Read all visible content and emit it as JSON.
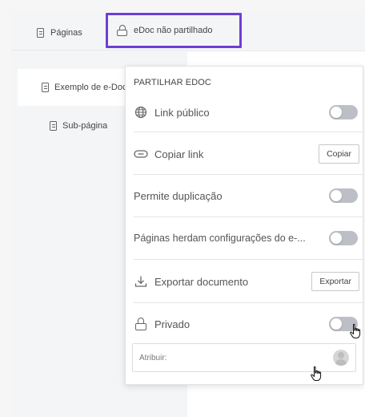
{
  "tabs": {
    "pages_label": "Páginas",
    "edoc_label": "eDoc não partilhado"
  },
  "sidebar": {
    "items": [
      {
        "label": "Exemplo de e-Doc"
      },
      {
        "label": "Sub-página"
      }
    ]
  },
  "share_menu": {
    "title": "PARTILHAR EDOC",
    "public_link": {
      "label": "Link público",
      "enabled": false
    },
    "copy_link": {
      "label": "Copiar link",
      "button": "Copiar"
    },
    "allow_duplication": {
      "label": "Permite duplicação",
      "enabled": false
    },
    "pages_inherit": {
      "label": "Páginas herdam configurações do e-...",
      "enabled": false
    },
    "export": {
      "label": "Exportar documento",
      "button": "Exportar"
    },
    "private": {
      "label": "Privado",
      "enabled": false
    },
    "assign": {
      "placeholder": "Atribuir:"
    }
  },
  "colors": {
    "highlight": "#6c3fd6",
    "toggle_off": "#bcc0c6"
  },
  "icons": [
    "document-icon",
    "lock-icon",
    "globe-icon",
    "link-icon",
    "download-icon",
    "avatar-icon",
    "hand-pointer-icon"
  ]
}
